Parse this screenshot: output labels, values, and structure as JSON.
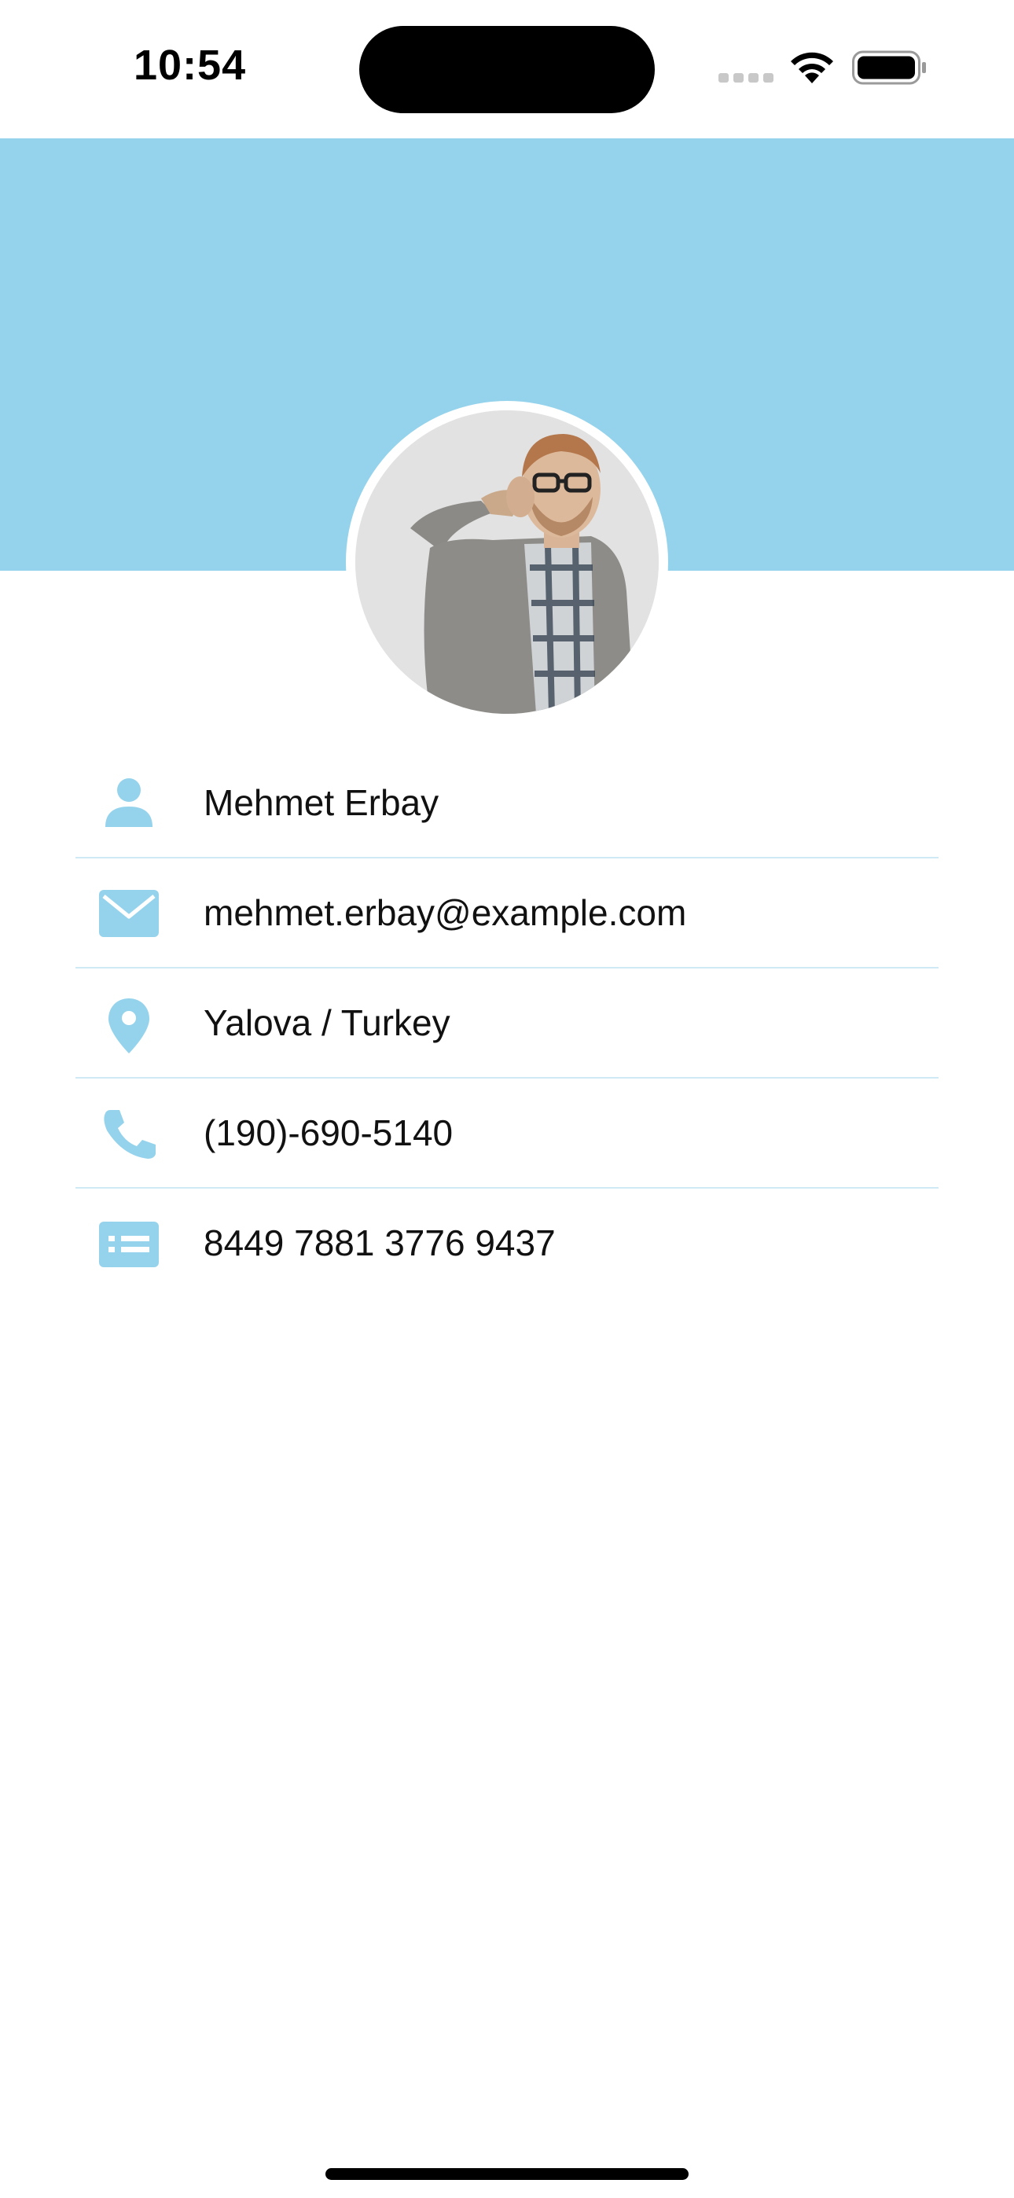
{
  "status_bar": {
    "time": "10:54"
  },
  "theme": {
    "accent": "#95d3ec",
    "divider": "#cfeaf5",
    "text": "#111111"
  },
  "profile": {
    "avatar_alt": "profile photo"
  },
  "info_rows": [
    {
      "icon": "person-icon",
      "label": "Mehmet Erbay"
    },
    {
      "icon": "envelope-icon",
      "label": "mehmet.erbay@example.com"
    },
    {
      "icon": "map-pin-icon",
      "label": "Yalova / Turkey"
    },
    {
      "icon": "phone-icon",
      "label": "(190)-690-5140"
    },
    {
      "icon": "id-card-icon",
      "label": "8449 7881 3776 9437"
    }
  ]
}
